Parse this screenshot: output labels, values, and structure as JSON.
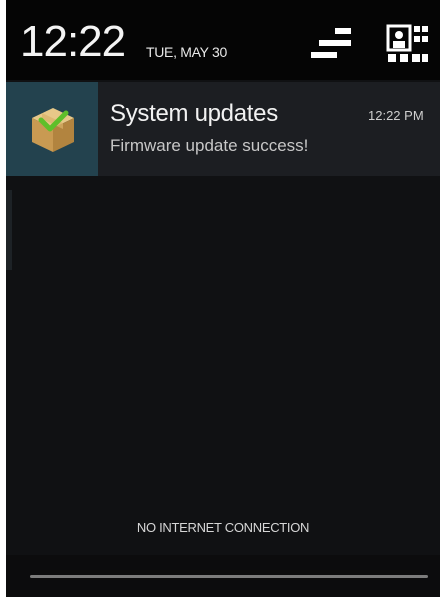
{
  "header": {
    "time": "12:22",
    "date": "TUE, MAY 30",
    "settings_icon": "quick-settings-icon",
    "profile_icon": "user-profile-icon"
  },
  "notification": {
    "icon": "package-update-icon",
    "title": "System updates",
    "time": "12:22 PM",
    "text": "Firmware update success!"
  },
  "footer": {
    "status": "NO INTERNET CONNECTION"
  },
  "colors": {
    "screen_bg": "#101113",
    "header_bg": "#050505",
    "notification_bg": "#1c1e22",
    "icon_bg": "#23424e",
    "check_green": "#5fbf2a",
    "box_tan": "#d8b06a"
  }
}
